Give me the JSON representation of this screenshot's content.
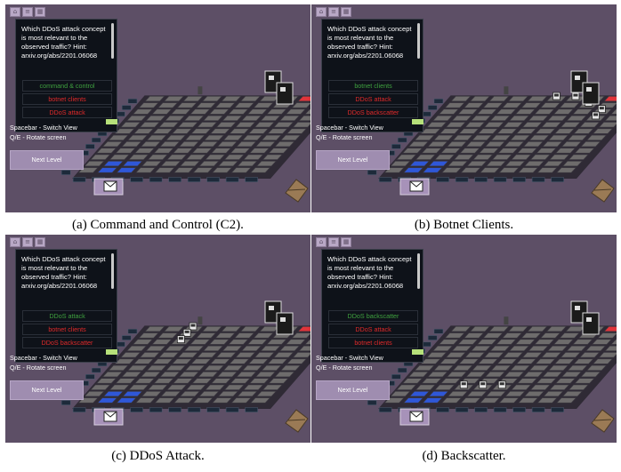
{
  "question": "Which DDoS attack concept is most relevant to the observed traffic? Hint: arxiv.org/abs/2201.06068",
  "controls": {
    "switch_view": "Spacebar - Switch View",
    "rotate": "Q/E - Rotate screen",
    "next_level": "Next Level"
  },
  "colors": {
    "correct": "#3fa13f",
    "wrong": "#e02a2a",
    "panel_bg": "#5d4f66",
    "tile": "#6e6c6c",
    "blue_tile": "#2f57d8",
    "red_tile": "#e0343a"
  },
  "panels": [
    {
      "options": [
        {
          "label": "command & control",
          "status": "correct"
        },
        {
          "label": "botnet clients",
          "status": "wrong"
        },
        {
          "label": "DDoS attack",
          "status": "wrong"
        }
      ],
      "caption": "(a) Command and Control (C2)."
    },
    {
      "options": [
        {
          "label": "botnet clients",
          "status": "correct"
        },
        {
          "label": "DDoS attack",
          "status": "wrong"
        },
        {
          "label": "DDoS backscatter",
          "status": "wrong"
        }
      ],
      "caption": "(b) Botnet Clients."
    },
    {
      "options": [
        {
          "label": "DDoS attack",
          "status": "correct"
        },
        {
          "label": "botnet clients",
          "status": "wrong"
        },
        {
          "label": "DDoS backscatter",
          "status": "wrong"
        }
      ],
      "caption": "(c) DDoS Attack."
    },
    {
      "options": [
        {
          "label": "DDoS backscatter",
          "status": "correct"
        },
        {
          "label": "DDoS attack",
          "status": "wrong"
        },
        {
          "label": "botnet clients",
          "status": "wrong"
        }
      ],
      "caption": "(d) Backscatter."
    }
  ],
  "icons": [
    "home-icon",
    "menu-icon",
    "grid-icon",
    "envelope-icon",
    "package-icon",
    "crate-icon",
    "server-icon"
  ]
}
